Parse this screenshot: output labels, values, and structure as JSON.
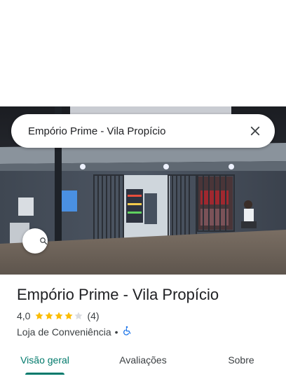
{
  "search": {
    "query": "Empório Prime - Vila Propício",
    "search_icon": "search-icon",
    "close_icon": "close-icon"
  },
  "place": {
    "name": "Empório Prime - Vila Propício",
    "rating": "4,0",
    "rating_value": 4,
    "rating_max": 5,
    "review_count": "(4)",
    "category": "Loja de Conveniência",
    "separator": "•",
    "accessibility_icon": "wheelchair-icon"
  },
  "tabs": [
    {
      "label": "Visão geral",
      "active": true
    },
    {
      "label": "Avaliações",
      "active": false
    },
    {
      "label": "Sobre",
      "active": false
    }
  ],
  "colors": {
    "accent": "#00796b",
    "star": "#fbbc04",
    "star_empty": "#dadce0",
    "accessibility": "#1a73e8"
  }
}
